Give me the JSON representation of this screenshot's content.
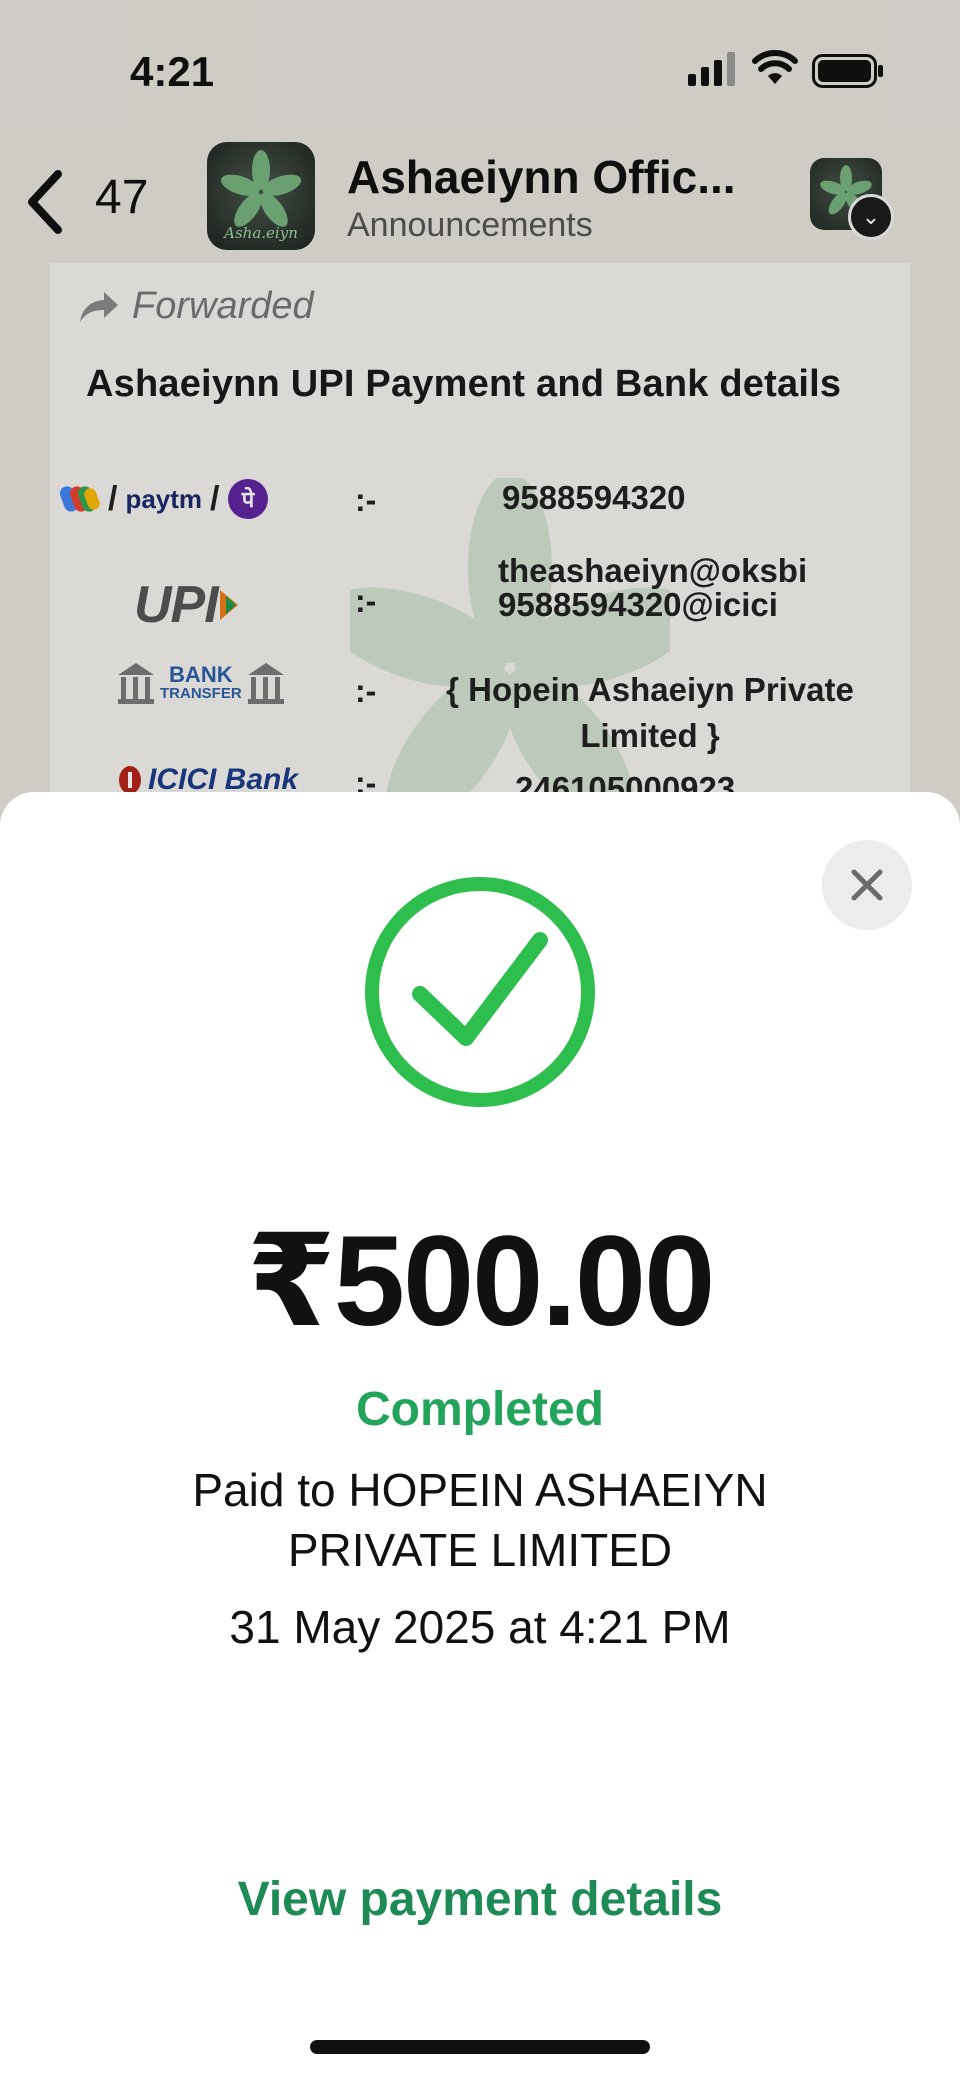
{
  "status_bar": {
    "time": "4:21"
  },
  "header": {
    "unread_count": "47",
    "group_title": "Ashaeiynn Offic...",
    "group_subtitle": "Announcements",
    "avatar_script": "Asha.eiyn"
  },
  "message": {
    "forwarded_label": "Forwarded",
    "title": "Ashaeiynn UPI Payment and Bank details",
    "rows": [
      {
        "method": "Paytm",
        "logo_text": "paytm",
        "separator": ":-",
        "value": "9588594320"
      },
      {
        "method": "UPI",
        "logo_text": "UPI",
        "separator": ":-",
        "value_line1": "theashaeiyn@oksbi",
        "value_line2": "9588594320@icici"
      },
      {
        "method": "Bank Transfer",
        "logo_text_1": "BANK",
        "logo_text_2": "TRANSFER",
        "separator": ":-",
        "value": "{ Hopein Ashaeiyn Private Limited }"
      },
      {
        "method": "ICICI Bank",
        "logo_text": "ICICI Bank",
        "separator": ":-",
        "value": "246105000923"
      }
    ]
  },
  "sheet": {
    "amount": "₹500.00",
    "status": "Completed",
    "paid_to": "Paid to HOPEIN ASHAEIYN PRIVATE LIMITED",
    "timestamp": "31 May 2025 at 4:21 PM",
    "view_details_label": "View payment details"
  },
  "colors": {
    "success_green": "#2dbe4e",
    "status_text_green": "#22a45a",
    "link_green": "#1e8a55"
  },
  "icons": {
    "back": "chevron-left-icon",
    "close": "close-icon",
    "success": "check-circle-icon",
    "forward": "forward-arrow-icon"
  }
}
